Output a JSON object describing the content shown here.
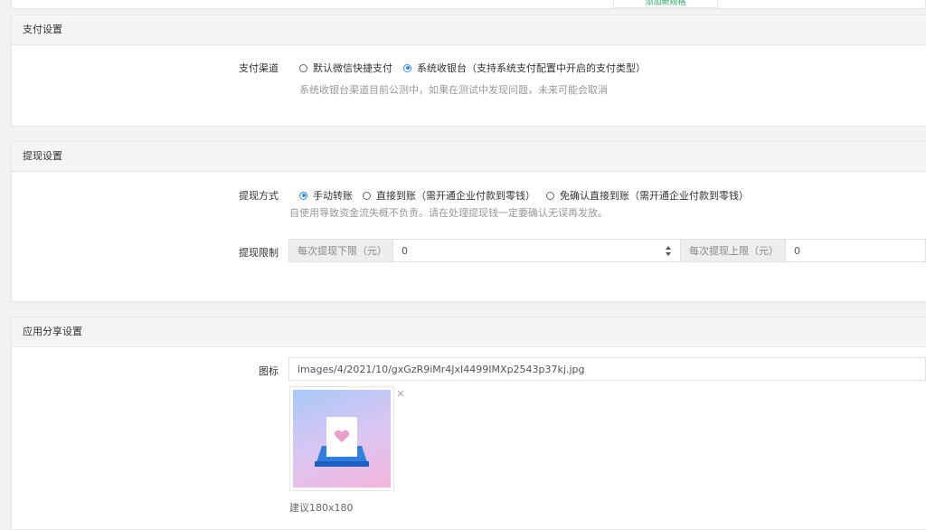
{
  "top_tab": {
    "label": "添加新规格"
  },
  "payment": {
    "header": "支付设置",
    "channel_label": "支付渠道",
    "options": [
      "默认微信快捷支付",
      "系统收银台（支持系统支付配置中开启的支付类型）"
    ],
    "selected": 1,
    "hint": "系统收银台渠道目前公测中，如果在测试中发现问题，未来可能会取消"
  },
  "withdraw": {
    "header": "提现设置",
    "method_label": "提现方式",
    "options": [
      "手动转账",
      "直接到账（需开通企业付款到零钱）",
      "免确认直接到账（需开通企业付款到零钱）"
    ],
    "selected": 0,
    "hint": "自使用导致资金流失概不负责。请在处理提现钱一定要确认无误再发放。",
    "limit_label": "提现限制",
    "min_addon": "每次提现下限（元）",
    "min_value": "0",
    "max_addon": "每次提现上限（元）",
    "max_value": "0"
  },
  "share": {
    "header": "应用分享设置",
    "icon_label": "图标",
    "icon_path": "images/4/2021/10/gxGzR9iMr4JxI4499IMXp2543p37kj.jpg",
    "close_symbol": "×",
    "size_hint": "建议180x180"
  }
}
